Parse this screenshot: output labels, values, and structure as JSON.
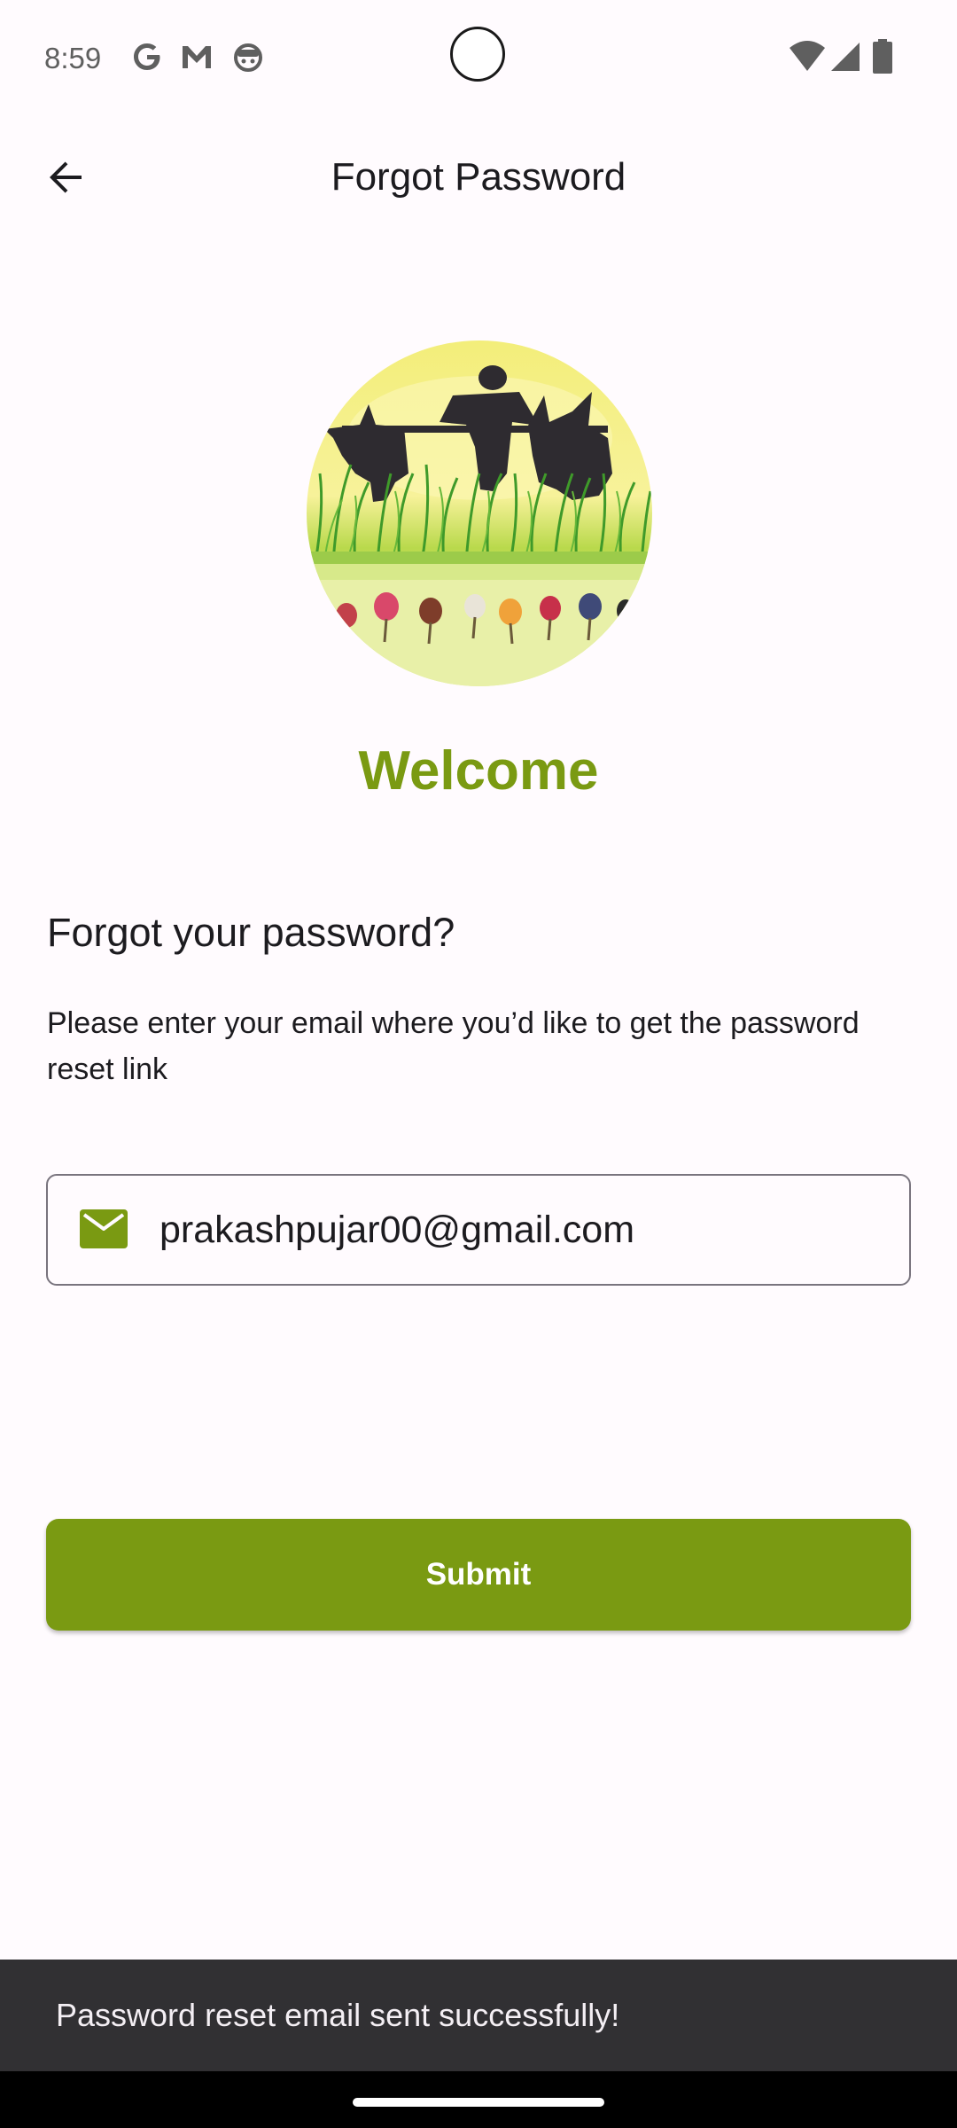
{
  "status_bar": {
    "time": "8:59",
    "left_icons": [
      "google-icon",
      "gmail-icon",
      "robot-face-icon"
    ],
    "right_icons": [
      "wifi-icon",
      "cellular-signal-icon",
      "battery-icon"
    ]
  },
  "app_bar": {
    "title": "Forgot Password",
    "back_icon": "arrow-back-icon"
  },
  "logo": {
    "icon": "farmers-oxen-logo"
  },
  "welcome_text": "Welcome",
  "form": {
    "heading": "Forgot your password?",
    "instructions": "Please enter your email where you’d like to get the password reset link",
    "email_icon": "mail-icon",
    "email_value": "prakashpujar00@gmail.com"
  },
  "submit_label": "Submit",
  "snackbar_message": "Password reset email sent successfully!",
  "colors": {
    "accent": "#7a9a12",
    "background": "#fffbfe",
    "snackbar": "#313033"
  }
}
